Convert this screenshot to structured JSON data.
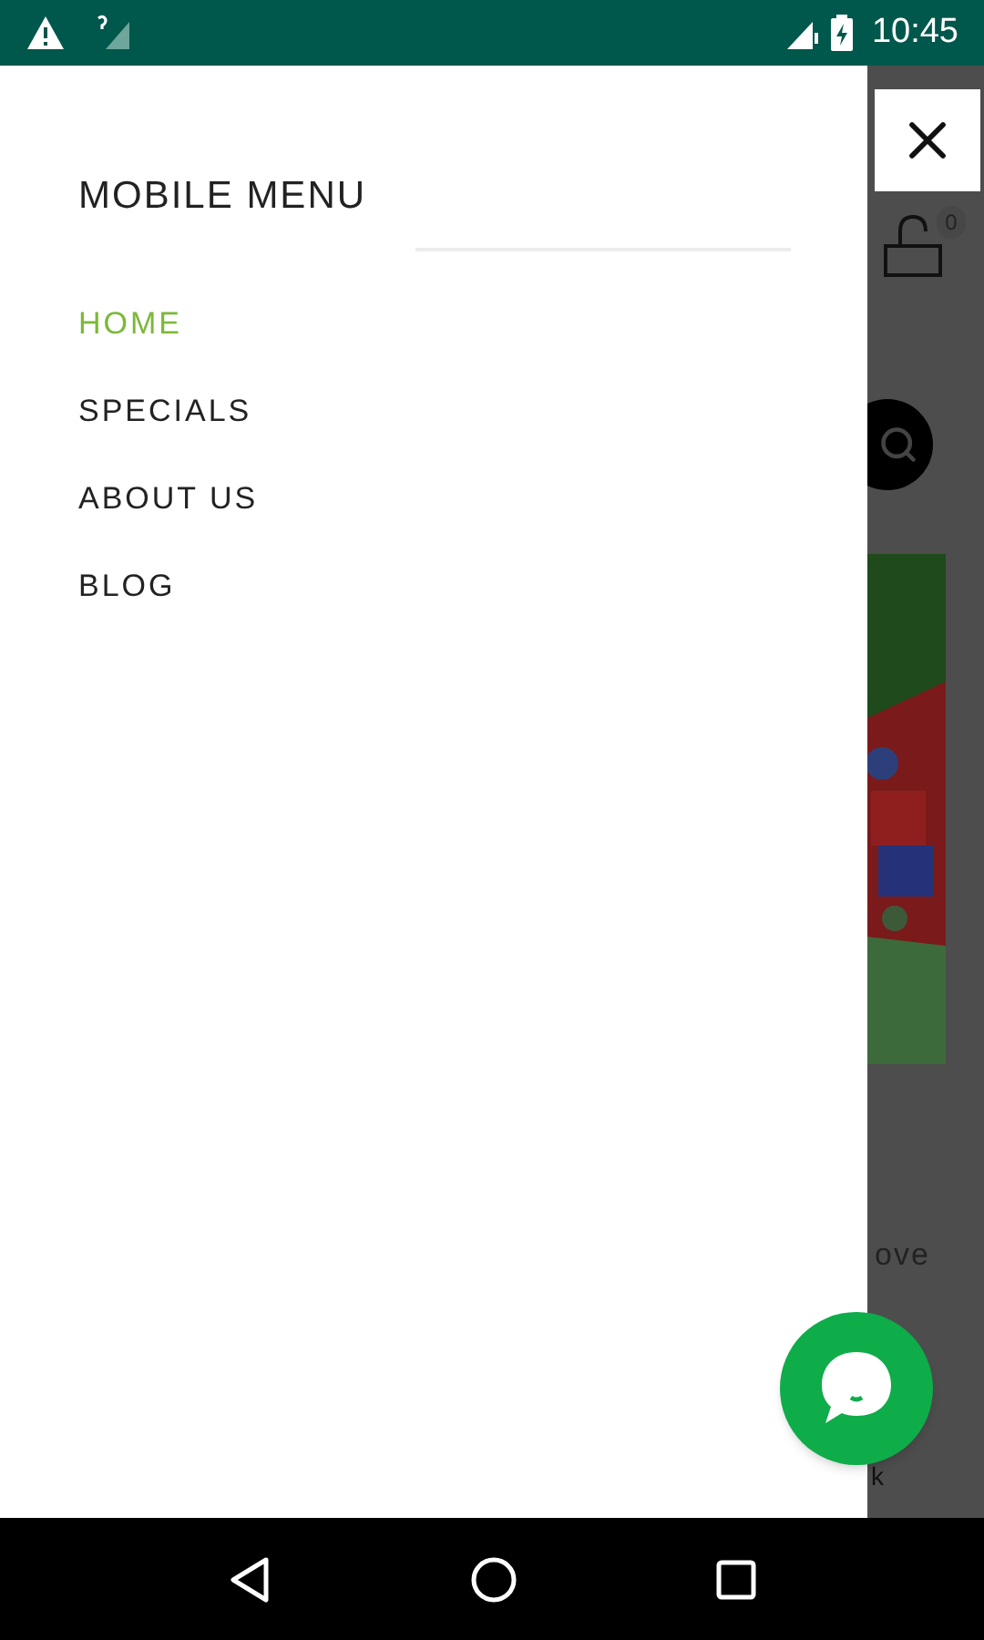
{
  "status_bar": {
    "time": "10:45"
  },
  "drawer": {
    "title": "MOBILE MENU",
    "items": [
      {
        "label": "HOME",
        "selected": true
      },
      {
        "label": "SPECIALS",
        "selected": false
      },
      {
        "label": "ABOUT US",
        "selected": false
      },
      {
        "label": "BLOG",
        "selected": false
      }
    ]
  },
  "background_page": {
    "cart_count": "0",
    "text_1": "ove",
    "text_2": "k"
  }
}
